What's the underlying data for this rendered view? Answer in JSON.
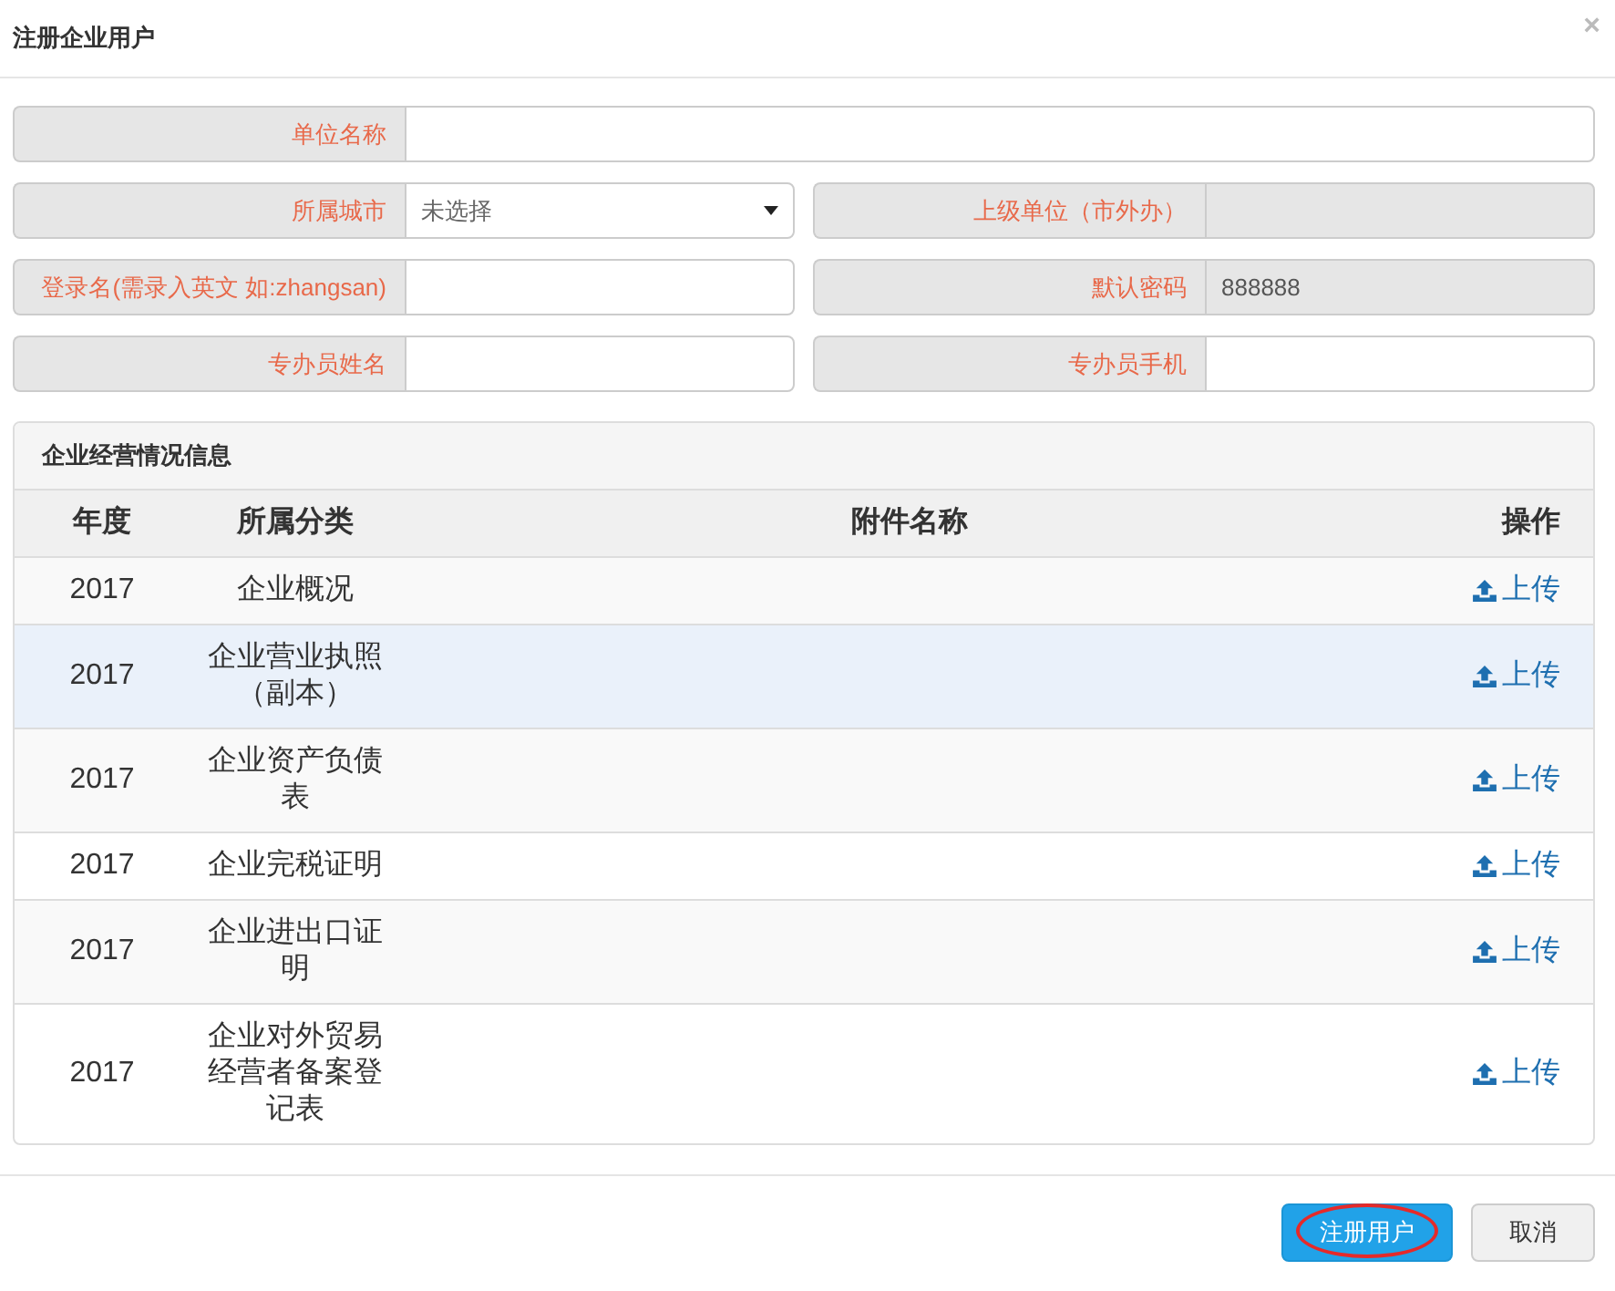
{
  "dialog": {
    "title": "注册企业用户",
    "close": "×"
  },
  "form": [
    [
      {
        "kind": "text",
        "label": "单位名称",
        "readonly": false
      }
    ],
    [
      {
        "kind": "select",
        "label": "所属城市",
        "value": "未选择"
      },
      {
        "kind": "text",
        "label": "上级单位（市外办）",
        "readonly": true
      }
    ],
    [
      {
        "kind": "text",
        "label": "登录名(需录入英文 如:zhangsan)",
        "readonly": false
      },
      {
        "kind": "text",
        "label": "默认密码",
        "value": "888888",
        "readonly": true
      }
    ],
    [
      {
        "kind": "text",
        "label": "专办员姓名",
        "readonly": false
      },
      {
        "kind": "text",
        "label": "专办员手机",
        "readonly": false
      }
    ]
  ],
  "panel": {
    "title": "企业经营情况信息",
    "columns": [
      "年度",
      "所属分类",
      "附件名称",
      "操作"
    ],
    "rows": [
      {
        "year": "2017",
        "category": "企业概况",
        "action": "上传",
        "selected": false
      },
      {
        "year": "2017",
        "category": "企业营业执照（副本）",
        "action": "上传",
        "selected": true
      },
      {
        "year": "2017",
        "category": "企业资产负债表",
        "action": "上传",
        "selected": false
      },
      {
        "year": "2017",
        "category": "企业完税证明",
        "action": "上传",
        "selected": false
      },
      {
        "year": "2017",
        "category": "企业进出口证明",
        "action": "上传",
        "selected": false
      },
      {
        "year": "2017",
        "category": "企业对外贸易经营者备案登记表",
        "action": "上传",
        "selected": false
      }
    ]
  },
  "buttons": [
    {
      "kind": "primary",
      "label": "注册用户",
      "circled": true
    },
    {
      "kind": "default",
      "label": "取消",
      "circled": false
    }
  ]
}
